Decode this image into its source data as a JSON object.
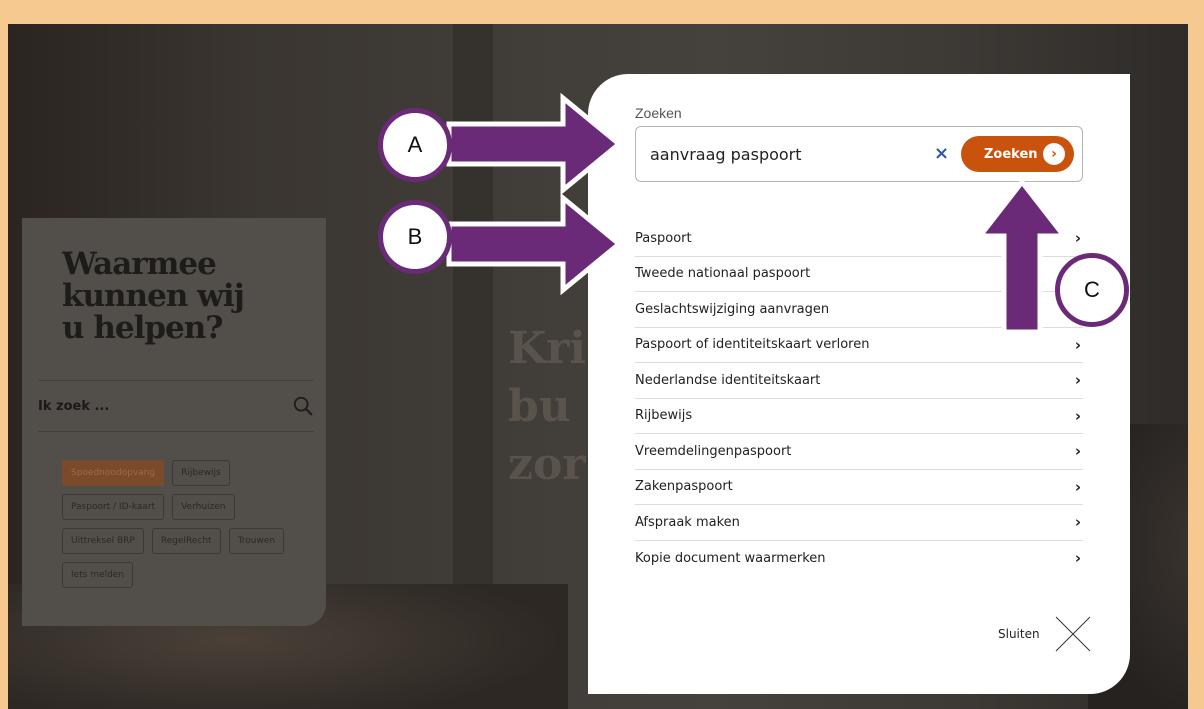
{
  "background": {
    "heading": "Kri\nbu\nzor"
  },
  "left_panel": {
    "title": "Waarmee\nkunnen wij\nu helpen?",
    "search_placeholder": "Ik zoek ...",
    "tags": [
      "Spoednoodopvang",
      "Rijbewijs",
      "Paspoort / ID-kaart",
      "Verhuizen",
      "Uittreksel BRP",
      "RegelRecht",
      "Trouwen",
      "Iets melden"
    ]
  },
  "modal": {
    "search_label": "Zoeken",
    "search_value": "aanvraag paspoort",
    "clear_symbol": "×",
    "submit_label": "Zoeken",
    "submit_icon": "›",
    "results": [
      "Paspoort",
      "Tweede nationaal paspoort",
      "Geslachtswijziging aanvragen",
      "Paspoort of identiteitskaart verloren",
      "Nederlandse identiteitskaart",
      "Rijbewijs",
      "Vreemdelingenpaspoort",
      "Zakenpaspoort",
      "Afspraak maken",
      "Kopie document waarmerken"
    ],
    "chevron": "›",
    "close_label": "Sluiten"
  },
  "annotations": {
    "a": "A",
    "b": "B",
    "c": "C",
    "arrow_color": "#6b2a78"
  },
  "colors": {
    "accent": "#c9520c",
    "frame": "#f5c98f"
  }
}
